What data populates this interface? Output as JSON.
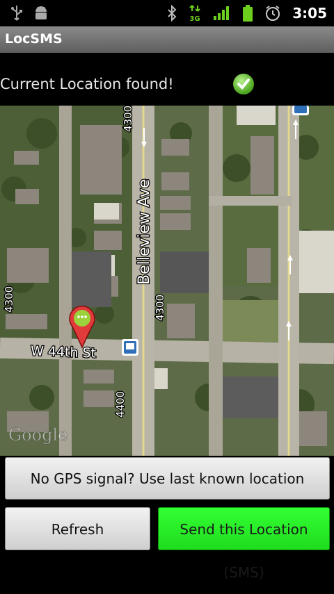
{
  "status_bar": {
    "time": "3:05",
    "network_label": "3G",
    "icons": [
      "usb-icon",
      "android-debug-icon",
      "bluetooth-icon",
      "3g-data-icon",
      "signal-icon",
      "battery-icon",
      "alarm-icon"
    ]
  },
  "app": {
    "title": "LocSMS"
  },
  "location": {
    "status_text": "Current Location found!",
    "status_icon": "check-icon"
  },
  "map": {
    "street_labels": {
      "belleview": "Belleview Ave",
      "w44th": "W 44th St",
      "n4300_top": "4300",
      "n4300_left": "4300",
      "n4300_mid": "4300",
      "n4400": "4400"
    },
    "watermark": "Google"
  },
  "buttons": {
    "last_known": "No GPS signal? Use last known location",
    "refresh": "Refresh",
    "send": "Send this Location (SMS)"
  },
  "colors": {
    "title_bar": "#6f6f6f",
    "send_button": "#2aee2a"
  }
}
